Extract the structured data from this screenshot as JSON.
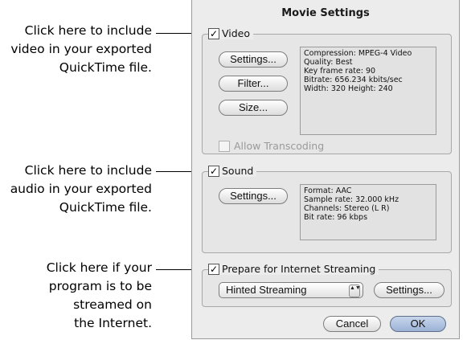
{
  "dialog": {
    "title": "Movie Settings"
  },
  "callouts": {
    "video": [
      "Click here to include",
      "video in your exported",
      "QuickTime file."
    ],
    "sound": [
      "Click here to include",
      "audio in your exported",
      "QuickTime file."
    ],
    "streaming": [
      "Click here if your",
      "program is to be",
      "streamed on",
      "the Internet."
    ]
  },
  "video": {
    "label": "Video",
    "checked": true,
    "buttons": {
      "settings": "Settings...",
      "filter": "Filter...",
      "size": "Size..."
    },
    "info": [
      "Compression: MPEG-4 Video",
      "Quality: Best",
      "Key frame rate: 90",
      "Bitrate: 656.234 kbits/sec",
      "Width: 320 Height: 240"
    ],
    "allow_transcoding": {
      "label": "Allow Transcoding",
      "checked": false,
      "enabled": false
    }
  },
  "sound": {
    "label": "Sound",
    "checked": true,
    "buttons": {
      "settings": "Settings..."
    },
    "info": [
      "Format: AAC",
      "Sample rate: 32.000 kHz",
      "Channels: Stereo (L R)",
      "Bit rate: 96 kbps"
    ]
  },
  "streaming": {
    "label": "Prepare for Internet Streaming",
    "checked": true,
    "selected_option": "Hinted Streaming",
    "buttons": {
      "settings": "Settings..."
    }
  },
  "footer": {
    "cancel": "Cancel",
    "ok": "OK"
  },
  "check_mark": "✓",
  "popup_arrows": "▲▼"
}
